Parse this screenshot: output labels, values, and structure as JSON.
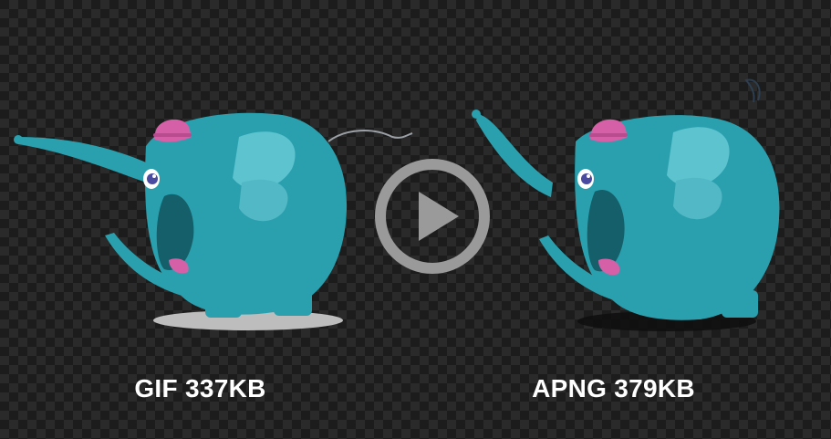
{
  "comparison": {
    "left": {
      "label": "GIF 337KB"
    },
    "right": {
      "label": "APNG 379KB"
    }
  },
  "colors": {
    "elephant_body": "#2aa0ae",
    "elephant_dark": "#1e7f8a",
    "hat": "#d660a8",
    "eye": "#4a4aa0",
    "play_ring": "#9a9a9a"
  },
  "icons": {
    "play": "play-icon"
  }
}
